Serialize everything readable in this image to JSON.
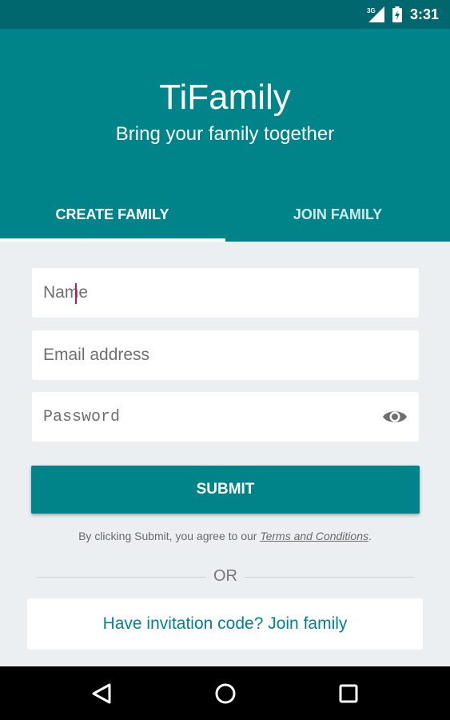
{
  "status_bar": {
    "network": "3G",
    "time": "3:31",
    "icons": [
      "signal-3g-icon",
      "battery-charging-icon"
    ]
  },
  "header": {
    "app_title": "TiFamily",
    "subtitle": "Bring your family together"
  },
  "tabs": [
    {
      "label": "CREATE FAMILY",
      "selected": true
    },
    {
      "label": "JOIN FAMILY",
      "selected": false
    }
  ],
  "form": {
    "name_placeholder": "Name",
    "name_value": "",
    "email_placeholder": "Email address",
    "email_value": "",
    "password_placeholder": "Password",
    "password_value": "",
    "submit_label": "SUBMIT"
  },
  "terms": {
    "prefix": "By clicking Submit, you agree to our ",
    "link": "Terms and Conditions",
    "suffix": "."
  },
  "separator_text": "OR",
  "join_link": "Have invitation code? Join family",
  "colors": {
    "primary": "#00848a",
    "status_bar": "#00676e",
    "background": "#eceff1",
    "cursor": "#c2185b"
  },
  "nav_icons": [
    "back-icon",
    "home-icon",
    "recents-icon"
  ]
}
